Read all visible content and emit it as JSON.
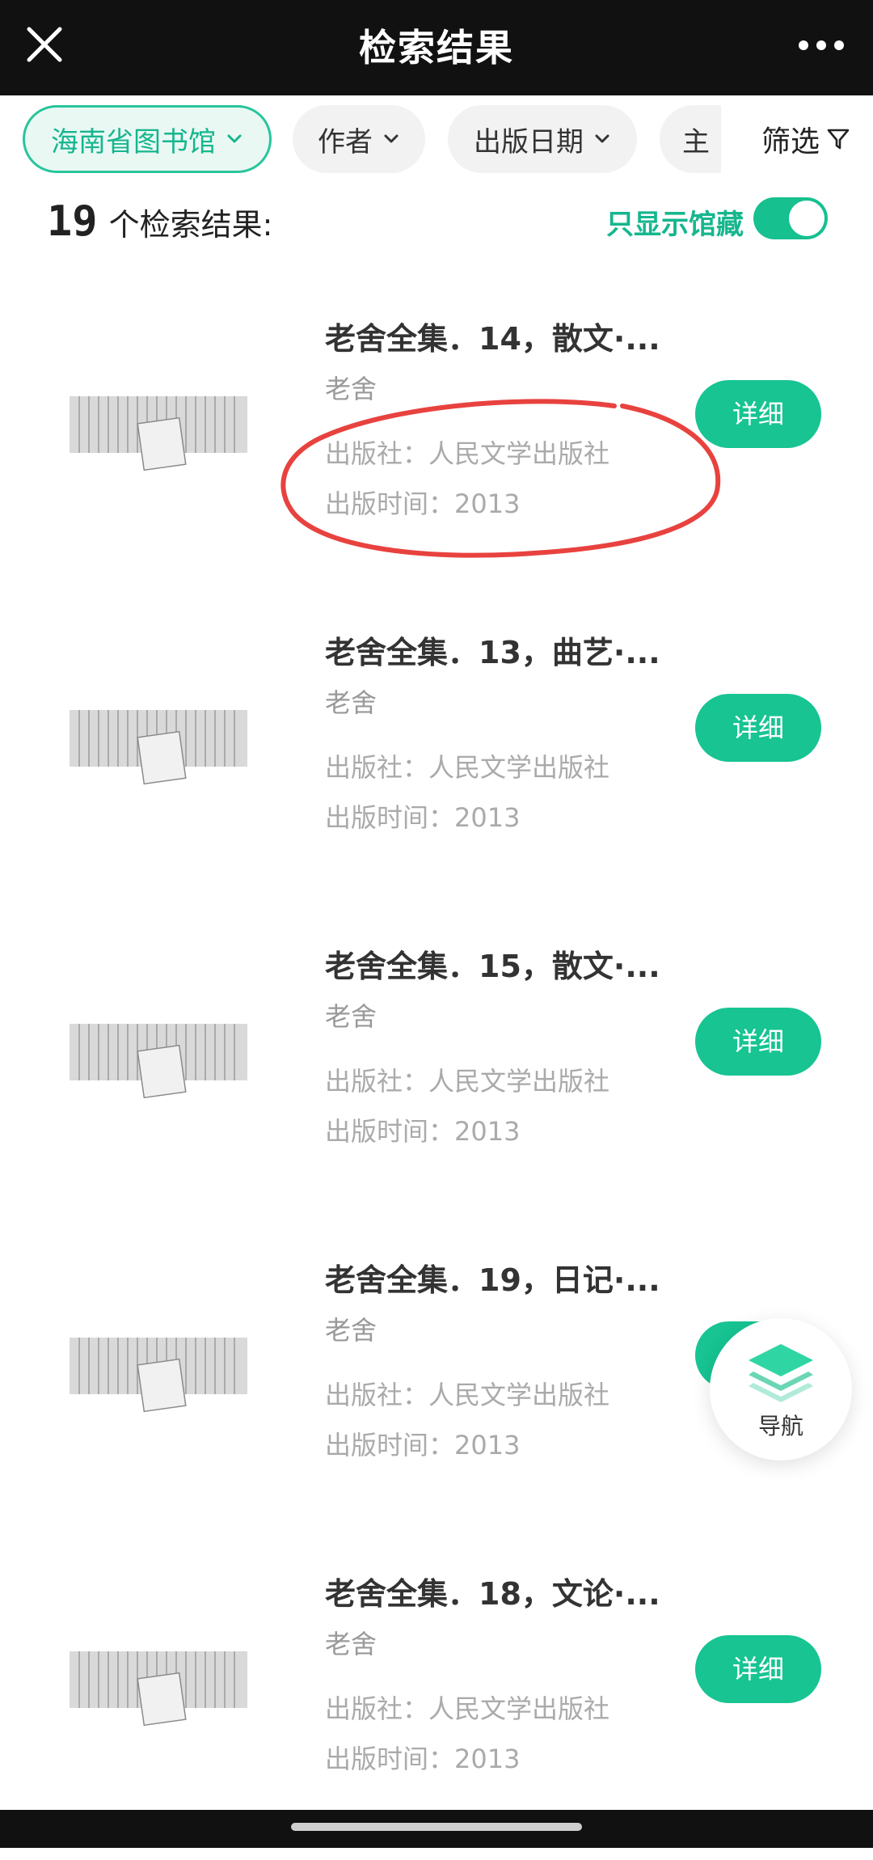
{
  "topbar": {
    "title": "检索结果",
    "close_icon": "close-icon",
    "more_icon": "more-dots-icon"
  },
  "filters": {
    "library": "海南省图书馆",
    "author": "作者",
    "date": "出版日期",
    "subject": "主",
    "filter_label": "筛选"
  },
  "results": {
    "count": "19",
    "count_text": "个检索结果:",
    "holdings_label": "只显示馆藏",
    "holdings_toggle_on": true
  },
  "items": [
    {
      "title": "老舍全集．14，散文·...",
      "author": "老舍",
      "publisher": "出版社：人民文学出版社",
      "pubtime": "出版时间：2013",
      "detail": "详细"
    },
    {
      "title": "老舍全集．13，曲艺·...",
      "author": "老舍",
      "publisher": "出版社：人民文学出版社",
      "pubtime": "出版时间：2013",
      "detail": "详细"
    },
    {
      "title": "老舍全集．15，散文·...",
      "author": "老舍",
      "publisher": "出版社：人民文学出版社",
      "pubtime": "出版时间：2013",
      "detail": "详细"
    },
    {
      "title": "老舍全集．19，日记·...",
      "author": "老舍",
      "publisher": "出版社：人民文学出版社",
      "pubtime": "出版时间：2013",
      "detail": "详细"
    },
    {
      "title": "老舍全集．18，文论·...",
      "author": "老舍",
      "publisher": "出版社：人民文学出版社",
      "pubtime": "出版时间：2013",
      "detail": "详细"
    }
  ],
  "nav": {
    "label": "导航"
  },
  "colors": {
    "accent": "#17c492",
    "annotation": "#e8423f",
    "topbar": "#111111"
  }
}
